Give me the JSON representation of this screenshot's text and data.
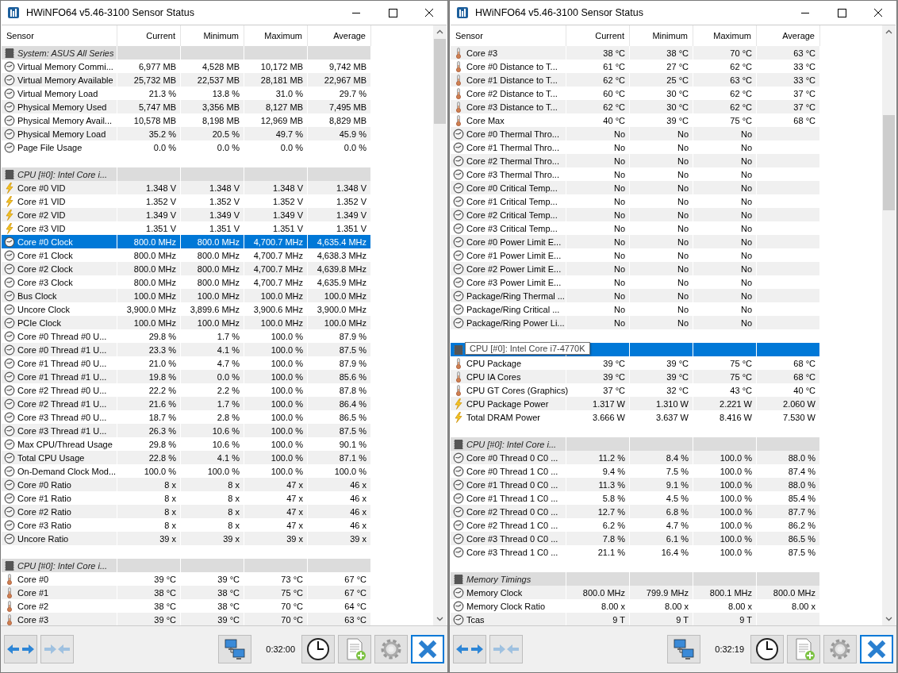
{
  "windows": [
    {
      "title": "HWiNFO64 v5.46-3100 Sensor Status",
      "columns": [
        "Sensor",
        "Current",
        "Minimum",
        "Maximum",
        "Average"
      ],
      "time": "0:32:00",
      "rows": [
        {
          "kind": "group",
          "label": "System: ASUS All Series",
          "selected": false
        },
        {
          "kind": "gauge",
          "label": "Virtual Memory Commi...",
          "values": [
            "6,977 MB",
            "4,528 MB",
            "10,172 MB",
            "9,742 MB"
          ],
          "selected": false
        },
        {
          "kind": "gauge",
          "label": "Virtual Memory Available",
          "values": [
            "25,732 MB",
            "22,537 MB",
            "28,181 MB",
            "22,967 MB"
          ],
          "selected": false
        },
        {
          "kind": "gauge",
          "label": "Virtual Memory Load",
          "values": [
            "21.3 %",
            "13.8 %",
            "31.0 %",
            "29.7 %"
          ],
          "selected": false
        },
        {
          "kind": "gauge",
          "label": "Physical Memory Used",
          "values": [
            "5,747 MB",
            "3,356 MB",
            "8,127 MB",
            "7,495 MB"
          ],
          "selected": false
        },
        {
          "kind": "gauge",
          "label": "Physical Memory Avail...",
          "values": [
            "10,578 MB",
            "8,198 MB",
            "12,969 MB",
            "8,829 MB"
          ],
          "selected": false
        },
        {
          "kind": "gauge",
          "label": "Physical Memory Load",
          "values": [
            "35.2 %",
            "20.5 %",
            "49.7 %",
            "45.9 %"
          ],
          "selected": false
        },
        {
          "kind": "gauge",
          "label": "Page File Usage",
          "values": [
            "0.0 %",
            "0.0 %",
            "0.0 %",
            "0.0 %"
          ],
          "selected": false
        },
        {
          "kind": "blank"
        },
        {
          "kind": "group",
          "label": "CPU [#0]: Intel Core i...",
          "selected": false
        },
        {
          "kind": "bolt",
          "label": "Core #0 VID",
          "values": [
            "1.348 V",
            "1.348 V",
            "1.348 V",
            "1.348 V"
          ],
          "selected": false
        },
        {
          "kind": "bolt",
          "label": "Core #1 VID",
          "values": [
            "1.352 V",
            "1.352 V",
            "1.352 V",
            "1.352 V"
          ],
          "selected": false
        },
        {
          "kind": "bolt",
          "label": "Core #2 VID",
          "values": [
            "1.349 V",
            "1.349 V",
            "1.349 V",
            "1.349 V"
          ],
          "selected": false
        },
        {
          "kind": "bolt",
          "label": "Core #3 VID",
          "values": [
            "1.351 V",
            "1.351 V",
            "1.351 V",
            "1.351 V"
          ],
          "selected": false
        },
        {
          "kind": "gauge",
          "label": "Core #0 Clock",
          "values": [
            "800.0 MHz",
            "800.0 MHz",
            "4,700.7 MHz",
            "4,635.4 MHz"
          ],
          "selected": true
        },
        {
          "kind": "gauge",
          "label": "Core #1 Clock",
          "values": [
            "800.0 MHz",
            "800.0 MHz",
            "4,700.7 MHz",
            "4,638.3 MHz"
          ],
          "selected": false
        },
        {
          "kind": "gauge",
          "label": "Core #2 Clock",
          "values": [
            "800.0 MHz",
            "800.0 MHz",
            "4,700.7 MHz",
            "4,639.8 MHz"
          ],
          "selected": false
        },
        {
          "kind": "gauge",
          "label": "Core #3 Clock",
          "values": [
            "800.0 MHz",
            "800.0 MHz",
            "4,700.7 MHz",
            "4,635.9 MHz"
          ],
          "selected": false
        },
        {
          "kind": "gauge",
          "label": "Bus Clock",
          "values": [
            "100.0 MHz",
            "100.0 MHz",
            "100.0 MHz",
            "100.0 MHz"
          ],
          "selected": false
        },
        {
          "kind": "gauge",
          "label": "Uncore Clock",
          "values": [
            "3,900.0 MHz",
            "3,899.6 MHz",
            "3,900.6 MHz",
            "3,900.0 MHz"
          ],
          "selected": false
        },
        {
          "kind": "gauge",
          "label": "PCIe Clock",
          "values": [
            "100.0 MHz",
            "100.0 MHz",
            "100.0 MHz",
            "100.0 MHz"
          ],
          "selected": false
        },
        {
          "kind": "gauge",
          "label": "Core #0 Thread #0 U...",
          "values": [
            "29.8 %",
            "1.7 %",
            "100.0 %",
            "87.9 %"
          ],
          "selected": false
        },
        {
          "kind": "gauge",
          "label": "Core #0 Thread #1 U...",
          "values": [
            "23.3 %",
            "4.1 %",
            "100.0 %",
            "87.5 %"
          ],
          "selected": false
        },
        {
          "kind": "gauge",
          "label": "Core #1 Thread #0 U...",
          "values": [
            "21.0 %",
            "4.7 %",
            "100.0 %",
            "87.9 %"
          ],
          "selected": false
        },
        {
          "kind": "gauge",
          "label": "Core #1 Thread #1 U...",
          "values": [
            "19.8 %",
            "0.0 %",
            "100.0 %",
            "85.6 %"
          ],
          "selected": false
        },
        {
          "kind": "gauge",
          "label": "Core #2 Thread #0 U...",
          "values": [
            "22.2 %",
            "2.2 %",
            "100.0 %",
            "87.8 %"
          ],
          "selected": false
        },
        {
          "kind": "gauge",
          "label": "Core #2 Thread #1 U...",
          "values": [
            "21.6 %",
            "1.7 %",
            "100.0 %",
            "86.4 %"
          ],
          "selected": false
        },
        {
          "kind": "gauge",
          "label": "Core #3 Thread #0 U...",
          "values": [
            "18.7 %",
            "2.8 %",
            "100.0 %",
            "86.5 %"
          ],
          "selected": false
        },
        {
          "kind": "gauge",
          "label": "Core #3 Thread #1 U...",
          "values": [
            "26.3 %",
            "10.6 %",
            "100.0 %",
            "87.5 %"
          ],
          "selected": false
        },
        {
          "kind": "gauge",
          "label": "Max CPU/Thread Usage",
          "values": [
            "29.8 %",
            "10.6 %",
            "100.0 %",
            "90.1 %"
          ],
          "selected": false
        },
        {
          "kind": "gauge",
          "label": "Total CPU Usage",
          "values": [
            "22.8 %",
            "4.1 %",
            "100.0 %",
            "87.1 %"
          ],
          "selected": false
        },
        {
          "kind": "gauge",
          "label": "On-Demand Clock Mod...",
          "values": [
            "100.0 %",
            "100.0 %",
            "100.0 %",
            "100.0 %"
          ],
          "selected": false
        },
        {
          "kind": "gauge",
          "label": "Core #0 Ratio",
          "values": [
            "8 x",
            "8 x",
            "47 x",
            "46 x"
          ],
          "selected": false
        },
        {
          "kind": "gauge",
          "label": "Core #1 Ratio",
          "values": [
            "8 x",
            "8 x",
            "47 x",
            "46 x"
          ],
          "selected": false
        },
        {
          "kind": "gauge",
          "label": "Core #2 Ratio",
          "values": [
            "8 x",
            "8 x",
            "47 x",
            "46 x"
          ],
          "selected": false
        },
        {
          "kind": "gauge",
          "label": "Core #3 Ratio",
          "values": [
            "8 x",
            "8 x",
            "47 x",
            "46 x"
          ],
          "selected": false
        },
        {
          "kind": "gauge",
          "label": "Uncore Ratio",
          "values": [
            "39 x",
            "39 x",
            "39 x",
            "39 x"
          ],
          "selected": false
        },
        {
          "kind": "blank"
        },
        {
          "kind": "group",
          "label": "CPU [#0]: Intel Core i...",
          "selected": false
        },
        {
          "kind": "thermo",
          "label": "Core #0",
          "values": [
            "39 °C",
            "39 °C",
            "73 °C",
            "67 °C"
          ],
          "selected": false
        },
        {
          "kind": "thermo",
          "label": "Core #1",
          "values": [
            "38 °C",
            "38 °C",
            "75 °C",
            "67 °C"
          ],
          "selected": false
        },
        {
          "kind": "thermo",
          "label": "Core #2",
          "values": [
            "38 °C",
            "38 °C",
            "70 °C",
            "64 °C"
          ],
          "selected": false
        },
        {
          "kind": "thermo",
          "label": "Core #3",
          "values": [
            "39 °C",
            "39 °C",
            "70 °C",
            "63 °C"
          ],
          "selected": false
        }
      ]
    },
    {
      "title": "HWiNFO64 v5.46-3100 Sensor Status",
      "columns": [
        "Sensor",
        "Current",
        "Minimum",
        "Maximum",
        "Average"
      ],
      "time": "0:32:19",
      "rows": [
        {
          "kind": "thermo",
          "label": "Core #3",
          "values": [
            "38 °C",
            "38 °C",
            "70 °C",
            "63 °C"
          ],
          "selected": false
        },
        {
          "kind": "thermo",
          "label": "Core #0 Distance to T...",
          "values": [
            "61 °C",
            "27 °C",
            "62 °C",
            "33 °C"
          ],
          "selected": false
        },
        {
          "kind": "thermo",
          "label": "Core #1 Distance to T...",
          "values": [
            "62 °C",
            "25 °C",
            "63 °C",
            "33 °C"
          ],
          "selected": false
        },
        {
          "kind": "thermo",
          "label": "Core #2 Distance to T...",
          "values": [
            "60 °C",
            "30 °C",
            "62 °C",
            "37 °C"
          ],
          "selected": false
        },
        {
          "kind": "thermo",
          "label": "Core #3 Distance to T...",
          "values": [
            "62 °C",
            "30 °C",
            "62 °C",
            "37 °C"
          ],
          "selected": false
        },
        {
          "kind": "thermo",
          "label": "Core Max",
          "values": [
            "40 °C",
            "39 °C",
            "75 °C",
            "68 °C"
          ],
          "selected": false
        },
        {
          "kind": "gauge",
          "label": "Core #0 Thermal Thro...",
          "values": [
            "No",
            "No",
            "No"
          ],
          "selected": false
        },
        {
          "kind": "gauge",
          "label": "Core #1 Thermal Thro...",
          "values": [
            "No",
            "No",
            "No"
          ],
          "selected": false
        },
        {
          "kind": "gauge",
          "label": "Core #2 Thermal Thro...",
          "values": [
            "No",
            "No",
            "No"
          ],
          "selected": false
        },
        {
          "kind": "gauge",
          "label": "Core #3 Thermal Thro...",
          "values": [
            "No",
            "No",
            "No"
          ],
          "selected": false
        },
        {
          "kind": "gauge",
          "label": "Core #0 Critical Temp...",
          "values": [
            "No",
            "No",
            "No"
          ],
          "selected": false
        },
        {
          "kind": "gauge",
          "label": "Core #1 Critical Temp...",
          "values": [
            "No",
            "No",
            "No"
          ],
          "selected": false
        },
        {
          "kind": "gauge",
          "label": "Core #2 Critical Temp...",
          "values": [
            "No",
            "No",
            "No"
          ],
          "selected": false
        },
        {
          "kind": "gauge",
          "label": "Core #3 Critical Temp...",
          "values": [
            "No",
            "No",
            "No"
          ],
          "selected": false
        },
        {
          "kind": "gauge",
          "label": "Core #0 Power Limit E...",
          "values": [
            "No",
            "No",
            "No"
          ],
          "selected": false
        },
        {
          "kind": "gauge",
          "label": "Core #1 Power Limit E...",
          "values": [
            "No",
            "No",
            "No"
          ],
          "selected": false
        },
        {
          "kind": "gauge",
          "label": "Core #2 Power Limit E...",
          "values": [
            "No",
            "No",
            "No"
          ],
          "selected": false
        },
        {
          "kind": "gauge",
          "label": "Core #3 Power Limit E...",
          "values": [
            "No",
            "No",
            "No"
          ],
          "selected": false
        },
        {
          "kind": "gauge",
          "label": "Package/Ring Thermal ...",
          "values": [
            "No",
            "No",
            "No"
          ],
          "selected": false
        },
        {
          "kind": "gauge",
          "label": "Package/Ring Critical ...",
          "values": [
            "No",
            "No",
            "No"
          ],
          "selected": false
        },
        {
          "kind": "gauge",
          "label": "Package/Ring Power Li...",
          "values": [
            "No",
            "No",
            "No"
          ],
          "selected": false
        },
        {
          "kind": "blank"
        },
        {
          "kind": "group",
          "selected": true,
          "tooltip": "CPU [#0]: Intel Core i7-4770K"
        },
        {
          "kind": "thermo",
          "label": "CPU Package",
          "values": [
            "39 °C",
            "39 °C",
            "75 °C",
            "68 °C"
          ],
          "selected": false
        },
        {
          "kind": "thermo",
          "label": "CPU IA Cores",
          "values": [
            "39 °C",
            "39 °C",
            "75 °C",
            "68 °C"
          ],
          "selected": false
        },
        {
          "kind": "thermo",
          "label": "CPU GT Cores (Graphics)",
          "values": [
            "37 °C",
            "32 °C",
            "43 °C",
            "40 °C"
          ],
          "selected": false
        },
        {
          "kind": "bolt",
          "label": "CPU Package Power",
          "values": [
            "1.317 W",
            "1.310 W",
            "2.221 W",
            "2.060 W"
          ],
          "selected": false
        },
        {
          "kind": "bolt",
          "label": "Total DRAM Power",
          "values": [
            "3.666 W",
            "3.637 W",
            "8.416 W",
            "7.530 W"
          ],
          "selected": false
        },
        {
          "kind": "blank"
        },
        {
          "kind": "group",
          "label": "CPU [#0]: Intel Core i...",
          "selected": false
        },
        {
          "kind": "gauge",
          "label": "Core #0 Thread 0 C0 ...",
          "values": [
            "11.2 %",
            "8.4 %",
            "100.0 %",
            "88.0 %"
          ],
          "selected": false
        },
        {
          "kind": "gauge",
          "label": "Core #0 Thread 1 C0 ...",
          "values": [
            "9.4 %",
            "7.5 %",
            "100.0 %",
            "87.4 %"
          ],
          "selected": false
        },
        {
          "kind": "gauge",
          "label": "Core #1 Thread 0 C0 ...",
          "values": [
            "11.3 %",
            "9.1 %",
            "100.0 %",
            "88.0 %"
          ],
          "selected": false
        },
        {
          "kind": "gauge",
          "label": "Core #1 Thread 1 C0 ...",
          "values": [
            "5.8 %",
            "4.5 %",
            "100.0 %",
            "85.4 %"
          ],
          "selected": false
        },
        {
          "kind": "gauge",
          "label": "Core #2 Thread 0 C0 ...",
          "values": [
            "12.7 %",
            "6.8 %",
            "100.0 %",
            "87.7 %"
          ],
          "selected": false
        },
        {
          "kind": "gauge",
          "label": "Core #2 Thread 1 C0 ...",
          "values": [
            "6.2 %",
            "4.7 %",
            "100.0 %",
            "86.2 %"
          ],
          "selected": false
        },
        {
          "kind": "gauge",
          "label": "Core #3 Thread 0 C0 ...",
          "values": [
            "7.8 %",
            "6.1 %",
            "100.0 %",
            "86.5 %"
          ],
          "selected": false
        },
        {
          "kind": "gauge",
          "label": "Core #3 Thread 1 C0 ...",
          "values": [
            "21.1 %",
            "16.4 %",
            "100.0 %",
            "87.5 %"
          ],
          "selected": false
        },
        {
          "kind": "blank"
        },
        {
          "kind": "group",
          "label": "Memory Timings",
          "selected": false
        },
        {
          "kind": "gauge",
          "label": "Memory Clock",
          "values": [
            "800.0 MHz",
            "799.9 MHz",
            "800.1 MHz",
            "800.0 MHz"
          ],
          "selected": false
        },
        {
          "kind": "gauge",
          "label": "Memory Clock Ratio",
          "values": [
            "8.00 x",
            "8.00 x",
            "8.00 x",
            "8.00 x"
          ],
          "selected": false
        },
        {
          "kind": "gauge",
          "label": "Tcas",
          "values": [
            "9 T",
            "9 T",
            "9 T"
          ],
          "selected": false
        }
      ]
    }
  ]
}
